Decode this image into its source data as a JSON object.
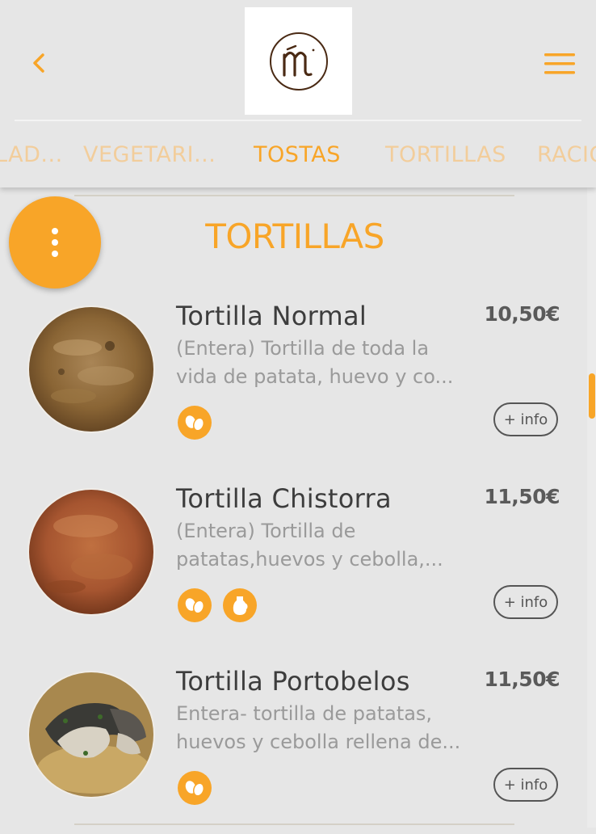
{
  "header": {
    "logo_alt": "m",
    "tabs": [
      {
        "label": "LAD..."
      },
      {
        "label": "VEGETARI..."
      },
      {
        "label": "TOSTAS"
      },
      {
        "label": "TORTILLAS"
      },
      {
        "label": "RACIO"
      }
    ],
    "active_tab_index": 2
  },
  "section": {
    "title": "TORTILLAS"
  },
  "items": [
    {
      "name": "Tortilla Normal",
      "price": "10,50€",
      "desc_line1": "(Entera) Tortilla de toda la",
      "desc_line2": "vida de patata, huevo y co...",
      "allergen_icons": [
        "eggs-icon"
      ],
      "info_label": "+ info"
    },
    {
      "name": "Tortilla Chistorra",
      "price": "11,50€",
      "desc_line1": "(Entera) Tortilla de",
      "desc_line2": "patatas,huevos y cebolla,...",
      "allergen_icons": [
        "eggs-icon",
        "milk-jug-icon"
      ],
      "info_label": "+ info"
    },
    {
      "name": "Tortilla Portobelos",
      "price": "11,50€",
      "desc_line1": "Entera- tortilla de patatas,",
      "desc_line2": "huevos y cebolla rellena de...",
      "allergen_icons": [
        "eggs-icon"
      ],
      "info_label": "+ info"
    }
  ],
  "colors": {
    "accent": "#f8a528",
    "tab_inactive": "#f2cd9b",
    "background": "#e6e6e6",
    "title_text": "#3d3d3d",
    "desc_text": "#9a9a9a"
  }
}
